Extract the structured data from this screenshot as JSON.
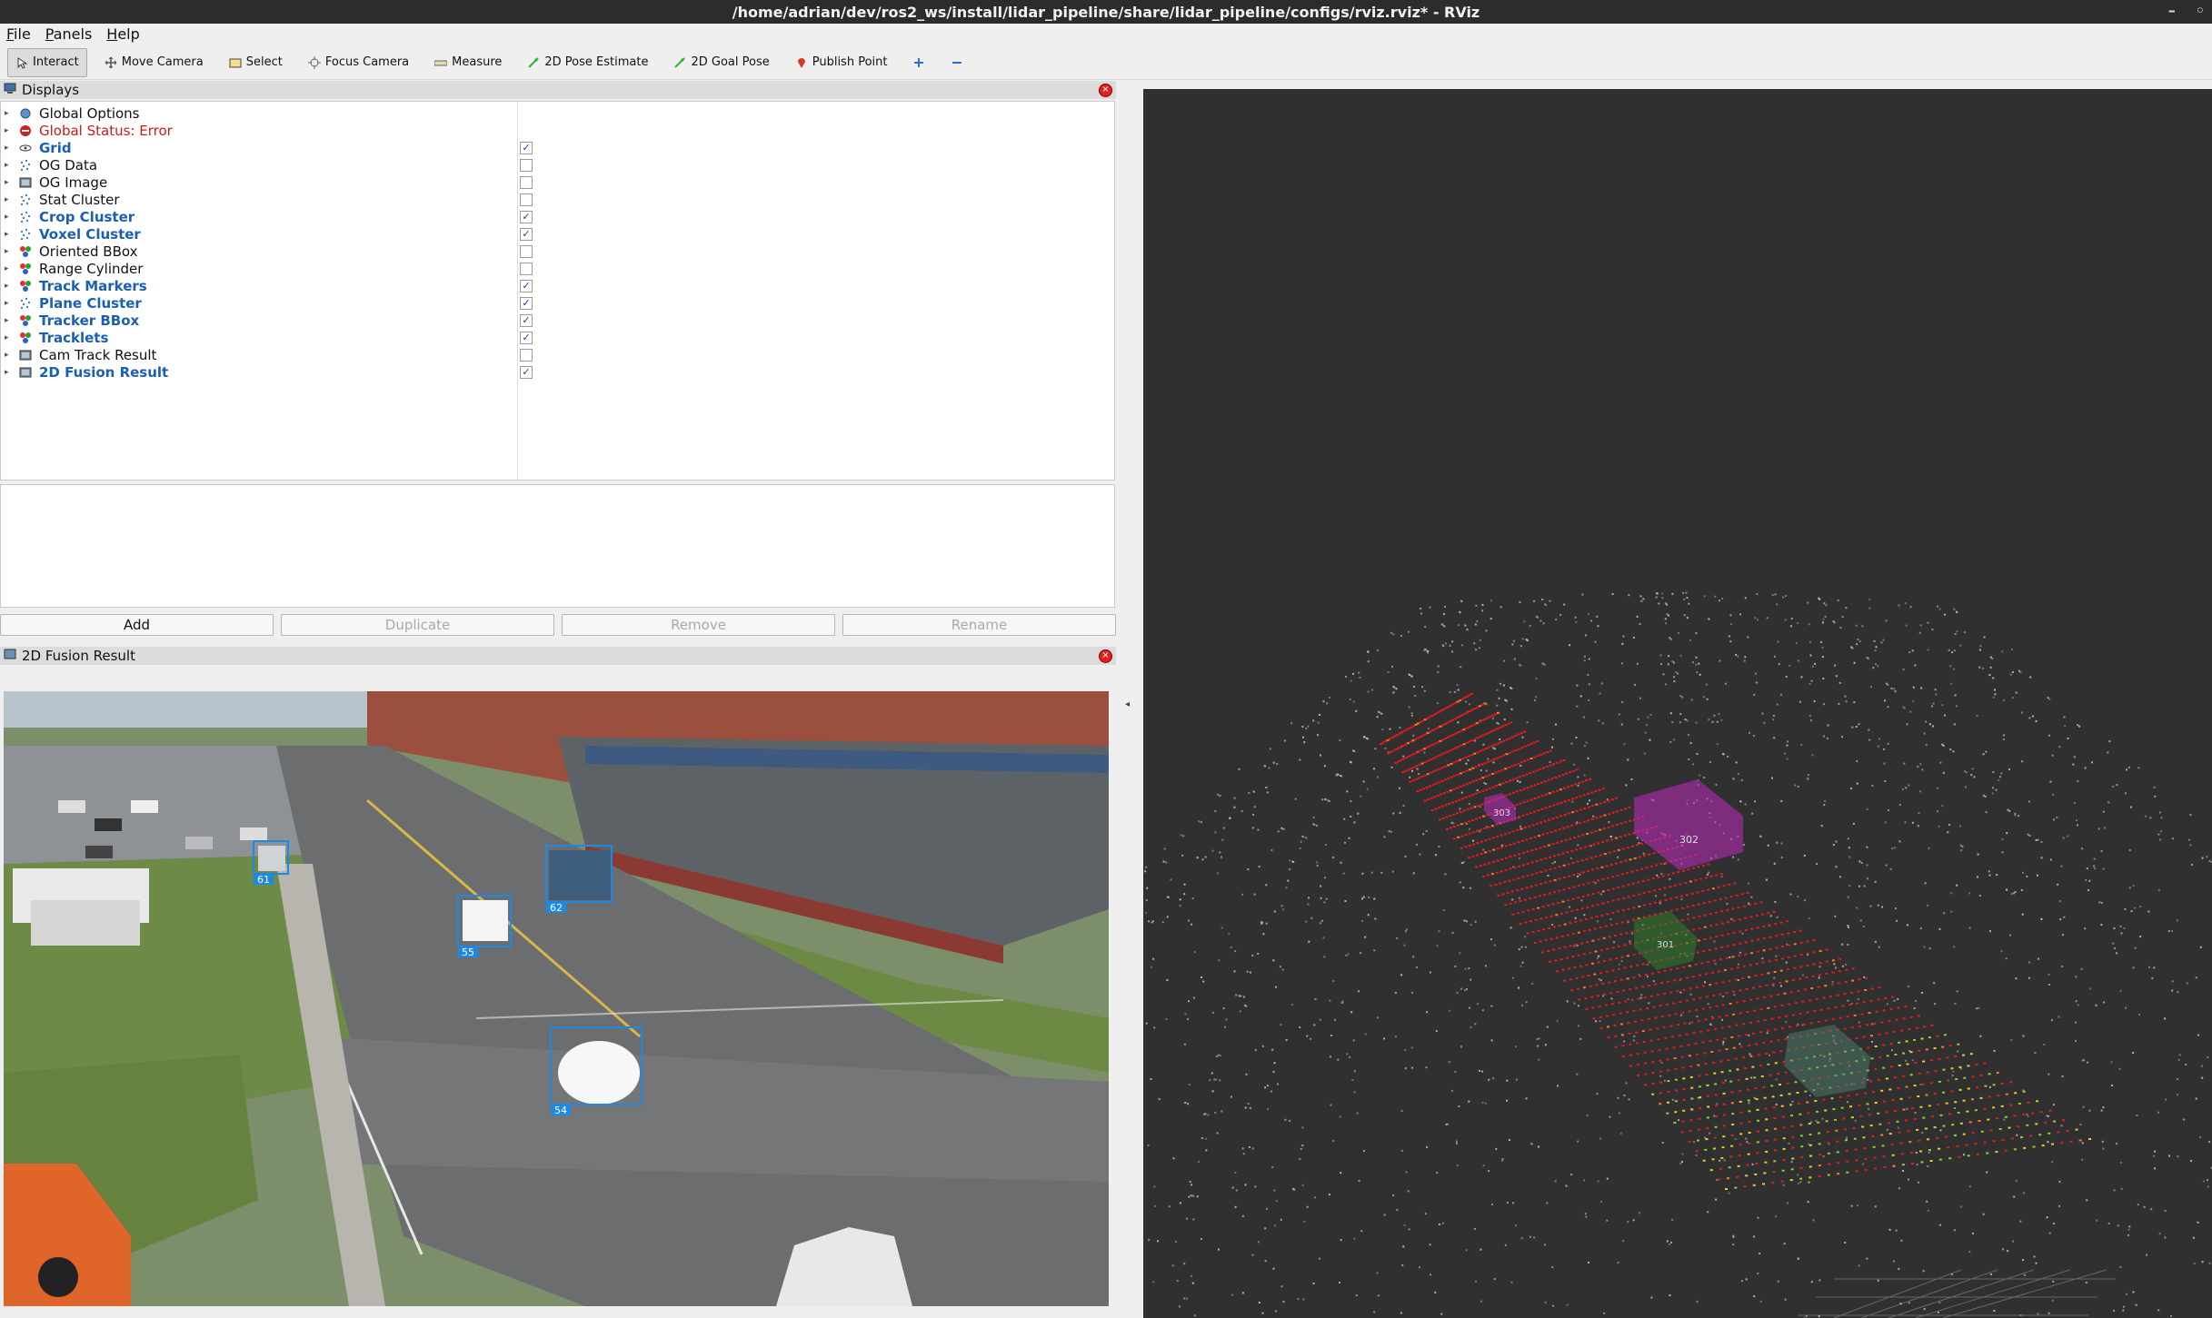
{
  "window": {
    "title": "/home/adrian/dev/ros2_ws/install/lidar_pipeline/share/lidar_pipeline/configs/rviz.rviz* - RViz"
  },
  "menu": [
    "File",
    "Panels",
    "Help"
  ],
  "toolbar": [
    {
      "label": "Interact",
      "icon": "interact-icon"
    },
    {
      "label": "Move Camera",
      "icon": "move-camera-icon"
    },
    {
      "label": "Select",
      "icon": "select-icon"
    },
    {
      "label": "Focus Camera",
      "icon": "focus-camera-icon"
    },
    {
      "label": "Measure",
      "icon": "measure-icon"
    },
    {
      "label": "2D Pose Estimate",
      "icon": "pose-estimate-icon"
    },
    {
      "label": "2D Goal Pose",
      "icon": "goal-pose-icon"
    },
    {
      "label": "Publish Point",
      "icon": "publish-point-icon"
    }
  ],
  "displays_panel": {
    "title": "Displays",
    "items": [
      {
        "label": "Global Options",
        "icon": "options-icon",
        "checkbox": null,
        "style": "normal"
      },
      {
        "label": "Global Status: Error",
        "icon": "error-icon",
        "checkbox": null,
        "style": "error"
      },
      {
        "label": "Grid",
        "icon": "grid-icon",
        "checkbox": true,
        "style": "enabled"
      },
      {
        "label": "OG Data",
        "icon": "pointcloud-icon",
        "checkbox": false,
        "style": "normal"
      },
      {
        "label": "OG Image",
        "icon": "image-icon",
        "checkbox": false,
        "style": "normal"
      },
      {
        "label": "Stat Cluster",
        "icon": "pointcloud-icon",
        "checkbox": false,
        "style": "normal"
      },
      {
        "label": "Crop Cluster",
        "icon": "pointcloud-icon",
        "checkbox": true,
        "style": "enabled"
      },
      {
        "label": "Voxel Cluster",
        "icon": "pointcloud-icon",
        "checkbox": true,
        "style": "enabled"
      },
      {
        "label": "Oriented BBox",
        "icon": "marker-icon",
        "checkbox": false,
        "style": "normal"
      },
      {
        "label": "Range Cylinder",
        "icon": "marker-icon",
        "checkbox": false,
        "style": "normal"
      },
      {
        "label": "Track Markers",
        "icon": "marker-icon",
        "checkbox": true,
        "style": "enabled"
      },
      {
        "label": "Plane Cluster",
        "icon": "pointcloud-icon",
        "checkbox": true,
        "style": "enabled"
      },
      {
        "label": "Tracker BBox",
        "icon": "marker-icon",
        "checkbox": true,
        "style": "enabled"
      },
      {
        "label": "Tracklets",
        "icon": "marker-icon",
        "checkbox": true,
        "style": "enabled"
      },
      {
        "label": "Cam Track Result",
        "icon": "image-icon",
        "checkbox": false,
        "style": "normal"
      },
      {
        "label": "2D Fusion Result",
        "icon": "image-icon",
        "checkbox": true,
        "style": "enabled"
      }
    ],
    "buttons": [
      {
        "label": "Add",
        "enabled": true
      },
      {
        "label": "Duplicate",
        "enabled": false
      },
      {
        "label": "Remove",
        "enabled": false
      },
      {
        "label": "Rename",
        "enabled": false
      }
    ]
  },
  "image_panel": {
    "title": "2D Fusion Result",
    "track_ids": [
      "61",
      "62",
      "55",
      "54"
    ]
  },
  "view3d": {
    "box_ids": [
      "302",
      "303",
      "301"
    ]
  },
  "colors": {
    "enabled_label": "#1a5fb4",
    "error_label": "#cc1a1a",
    "viewport_bg": "#303030",
    "bbox": "#1e88e5"
  }
}
